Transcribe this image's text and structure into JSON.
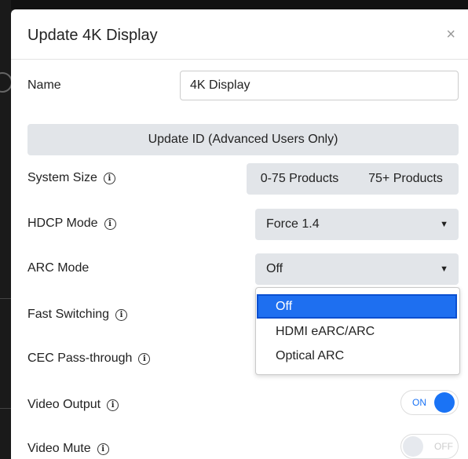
{
  "modal": {
    "title": "Update 4K Display",
    "close": "×"
  },
  "fields": {
    "name_label": "Name",
    "name_value": "4K Display",
    "update_id_label": "Update ID (Advanced Users Only)",
    "system_size_label": "System Size",
    "system_size_options": [
      "0-75 Products",
      "75+ Products"
    ],
    "hdcp_label": "HDCP Mode",
    "hdcp_value": "Force 1.4",
    "arc_label": "ARC Mode",
    "arc_value": "Off",
    "arc_options": [
      "Off",
      "HDMI eARC/ARC",
      "Optical ARC"
    ],
    "fast_switching_label": "Fast Switching",
    "cec_label": "CEC Pass-through",
    "video_output_label": "Video Output",
    "video_output_state": "ON",
    "video_mute_label": "Video Mute",
    "video_mute_state": "OFF"
  },
  "icons": {
    "info": "ⓘ",
    "caret": "▼"
  },
  "colors": {
    "accent": "#1a73f5",
    "selected_option": "#1e6ff0",
    "button_gray": "#e2e5e9"
  }
}
